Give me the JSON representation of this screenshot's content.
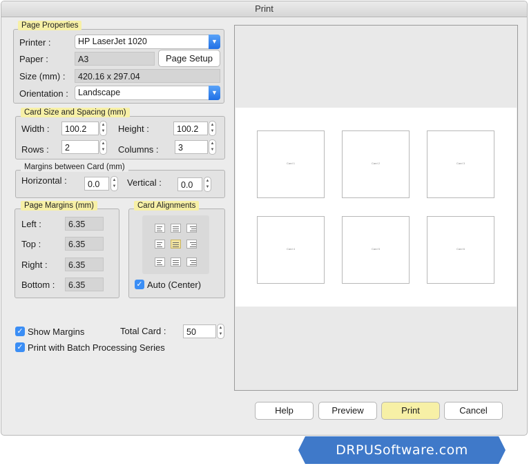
{
  "window": {
    "title": "Print"
  },
  "page_properties": {
    "legend": "Page Properties",
    "printer_label": "Printer :",
    "printer_value": "HP LaserJet 1020",
    "paper_label": "Paper :",
    "paper_value": "A3",
    "page_setup_label": "Page Setup",
    "size_label": "Size (mm) :",
    "size_value": "420.16 x 297.04",
    "orientation_label": "Orientation :",
    "orientation_value": "Landscape"
  },
  "card_size": {
    "legend": "Card Size and Spacing (mm)",
    "width_label": "Width :",
    "width_value": "100.2",
    "height_label": "Height :",
    "height_value": "100.2",
    "rows_label": "Rows :",
    "rows_value": "2",
    "columns_label": "Columns :",
    "columns_value": "3"
  },
  "margins_between": {
    "legend": "Margins between Card (mm)",
    "horizontal_label": "Horizontal :",
    "horizontal_value": "0.0",
    "vertical_label": "Vertical :",
    "vertical_value": "0.0"
  },
  "page_margins": {
    "legend": "Page Margins (mm)",
    "left_label": "Left :",
    "left_value": "6.35",
    "top_label": "Top :",
    "top_value": "6.35",
    "right_label": "Right :",
    "right_value": "6.35",
    "bottom_label": "Bottom :",
    "bottom_value": "6.35"
  },
  "card_alignments": {
    "legend": "Card Alignments",
    "selected": "middle-center",
    "auto_center_label": "Auto (Center)",
    "auto_center_checked": true
  },
  "options": {
    "show_margins_label": "Show Margins",
    "show_margins_checked": true,
    "batch_label": "Print with Batch Processing Series",
    "batch_checked": true,
    "total_card_label": "Total Card :",
    "total_card_value": "50"
  },
  "preview": {
    "cards": [
      "Card 1",
      "Card 2",
      "Card 3",
      "Card 4",
      "Card 5",
      "Card 6"
    ]
  },
  "buttons": {
    "help": "Help",
    "preview": "Preview",
    "print": "Print",
    "cancel": "Cancel"
  },
  "branding": {
    "text": "DRPUSoftware.com"
  },
  "colors": {
    "highlight": "#f7f0a6",
    "accent": "#3b8ef5",
    "banner": "#3f79c9"
  }
}
